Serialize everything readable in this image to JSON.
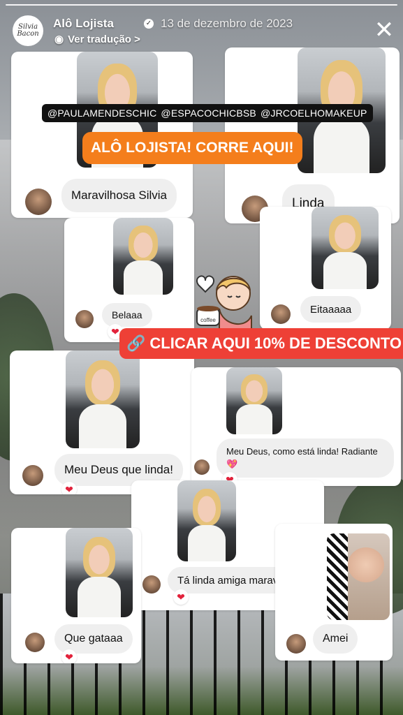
{
  "header": {
    "avatar_text": "Silvia Bacon",
    "username": "Alô Lojista",
    "date": "13 de dezembro de 2023",
    "translate_label": "Ver tradução",
    "translate_chevron": ">",
    "close_icon": "close-icon"
  },
  "stickers": {
    "mentions": [
      "@PAULAMENDESCHIC",
      "@ESPACOCHICBSB",
      "@JRCOELHOMAKEUP"
    ],
    "cta_orange": "ALÔ LOJISTA! CORRE AQUI!",
    "cta_red": "CLICAR AQUI 10% DE DESCONTO",
    "coffee_label": "coffee"
  },
  "comments": [
    {
      "text": "Maravilhosa Silvia",
      "liked": false
    },
    {
      "text": "Linda",
      "liked": false
    },
    {
      "text": "Belaaa",
      "liked": true
    },
    {
      "text": "Eitaaaaa",
      "liked": false
    },
    {
      "text": "Meu Deus que linda!",
      "liked": true
    },
    {
      "text": "Meu Deus, como está linda! Radiante 💖",
      "liked": true
    },
    {
      "text": "Tá linda amiga maravilhosa",
      "liked": true
    },
    {
      "text": "Que gataaa",
      "liked": true
    },
    {
      "text": "Amei",
      "liked": false
    }
  ],
  "heart_glyph": "❤",
  "link_glyph": "🔗",
  "colors": {
    "cta_orange": "#f47e1c",
    "cta_red": "#ee4036",
    "heart": "#e2223b"
  }
}
